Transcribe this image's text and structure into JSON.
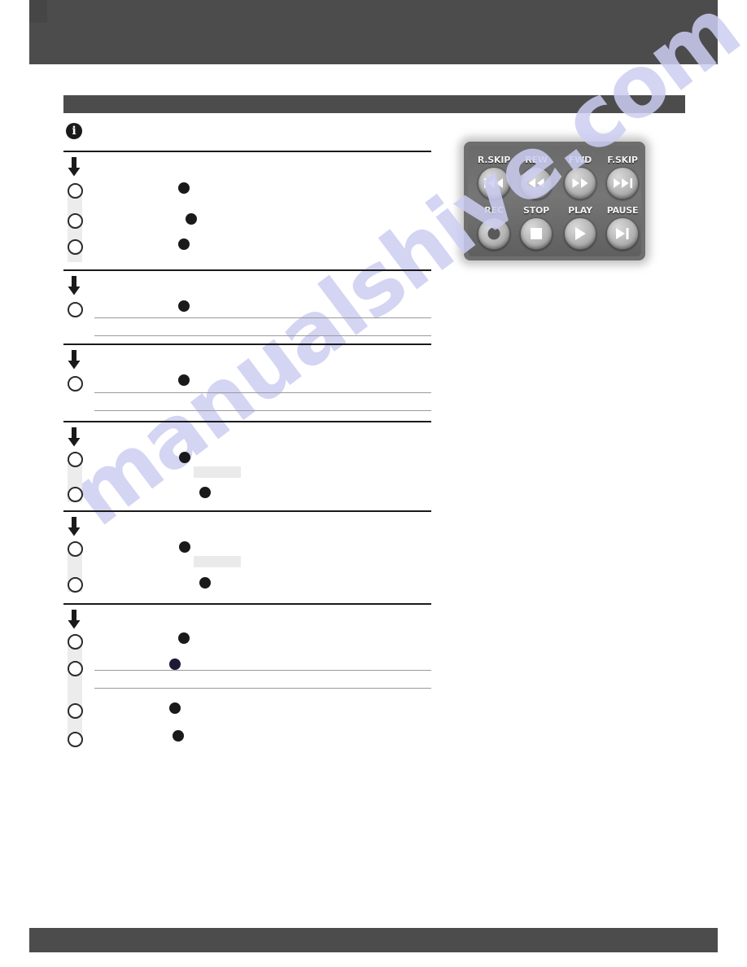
{
  "page": {
    "watermark_text": "manualshive.com",
    "background_color": "#ffffff",
    "bar_color": "#4c4c4c",
    "rule_color": "#1a1a1a",
    "step_band_color": "#ececec",
    "keycap_color": "#eaeaea",
    "watermark_color": "#cdcdf2"
  },
  "header": {
    "title": ""
  },
  "section": {
    "title": ""
  },
  "footer": {
    "text": ""
  },
  "note": {
    "icon": "info-icon",
    "text": ""
  },
  "procedures": [
    {
      "arrow_icon": "arrow-down-icon",
      "heading": "",
      "steps": [
        {
          "marker": "",
          "text": "",
          "bullet": true
        },
        {
          "marker": "",
          "text": "",
          "bullet": true
        },
        {
          "marker": "",
          "text": "",
          "bullet": true
        }
      ]
    },
    {
      "arrow_icon": "arrow-down-icon",
      "heading": "",
      "steps": [
        {
          "marker": "",
          "text": "",
          "bullet": true
        }
      ]
    },
    {
      "arrow_icon": "arrow-down-icon",
      "heading": "",
      "steps": [
        {
          "marker": "",
          "text": "",
          "bullet": true
        }
      ]
    },
    {
      "arrow_icon": "arrow-down-icon",
      "heading": "",
      "steps": [
        {
          "marker": "",
          "text": "",
          "bullet": true,
          "keycap": ""
        },
        {
          "marker": "",
          "text": "",
          "bullet": true
        }
      ]
    },
    {
      "arrow_icon": "arrow-down-icon",
      "heading": "",
      "steps": [
        {
          "marker": "",
          "text": "",
          "bullet": true,
          "keycap": ""
        },
        {
          "marker": "",
          "text": "",
          "bullet": true
        }
      ]
    },
    {
      "arrow_icon": "arrow-down-icon",
      "heading": "",
      "steps": [
        {
          "marker": "",
          "text": "",
          "bullet": true
        },
        {
          "marker": "",
          "text": "",
          "bullet": true
        },
        {
          "marker": "",
          "text": "",
          "bullet": true
        },
        {
          "marker": "",
          "text": "",
          "bullet": true
        }
      ]
    }
  ],
  "remote": {
    "caption": "",
    "body_color": "#6e6e6e",
    "buttons": [
      {
        "label": "R.SKIP",
        "icon": "skip-back-icon"
      },
      {
        "label": "REW",
        "icon": "rewind-icon"
      },
      {
        "label": "FWD",
        "icon": "fast-forward-icon"
      },
      {
        "label": "F.SKIP",
        "icon": "skip-forward-icon"
      },
      {
        "label": "REC",
        "icon": "record-icon"
      },
      {
        "label": "STOP",
        "icon": "stop-icon"
      },
      {
        "label": "PLAY",
        "icon": "play-icon"
      },
      {
        "label": "PAUSE",
        "icon": "pause-step-icon"
      }
    ]
  }
}
